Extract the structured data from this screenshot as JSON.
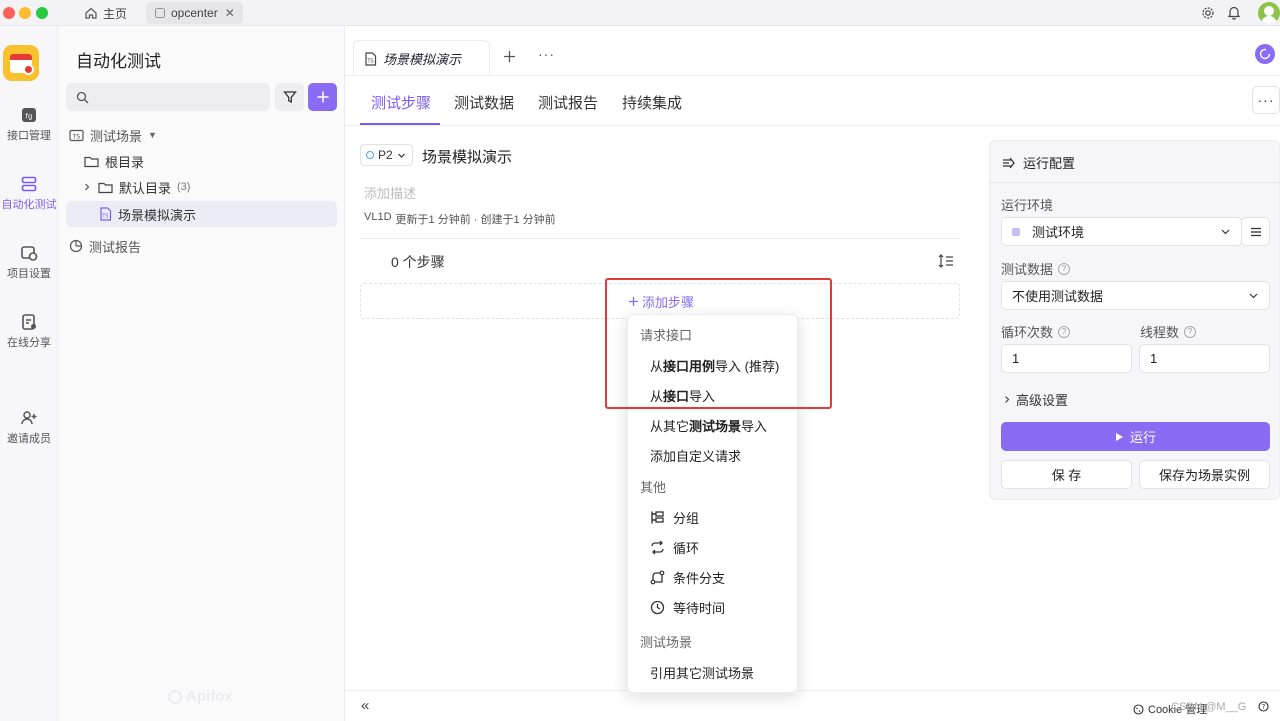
{
  "titlebar": {
    "home_tab": "主页",
    "project_tab": "opcenter"
  },
  "rail": {
    "items": [
      {
        "label": "接口管理"
      },
      {
        "label": "自动化测试"
      },
      {
        "label": "项目设置"
      },
      {
        "label": "在线分享"
      },
      {
        "label": "邀请成员"
      }
    ]
  },
  "nav": {
    "title": "自动化测试",
    "search_placeholder": "",
    "tree": {
      "root_section": "测试场景",
      "root_dir": "根目录",
      "default_dir": "默认目录",
      "default_dir_count": "(3)",
      "scene_item": "场景模拟演示",
      "report_section": "测试报告"
    },
    "watermark": "Apifox"
  },
  "doc_tab": {
    "title": "场景模拟演示"
  },
  "subtabs": [
    "测试步骤",
    "测试数据",
    "测试报告",
    "持续集成"
  ],
  "scene": {
    "priority": "P2",
    "title": "场景模拟演示",
    "desc_placeholder": "添加描述",
    "meta_user": "VL1D",
    "meta_text": "更新于1 分钟前 · 创建于1 分钟前",
    "steps_count": "0 个步骤",
    "add_step": "添加步骤"
  },
  "menu": {
    "section_request": "请求接口",
    "item_import_case_pre": "从",
    "item_import_case_bold": "接口用例",
    "item_import_case_post": "导入 (推荐)",
    "item_import_api_pre": "从",
    "item_import_api_bold": "接口",
    "item_import_api_post": "导入",
    "item_import_scene_pre": "从其它",
    "item_import_scene_bold": "测试场景",
    "item_import_scene_post": "导入",
    "item_custom": "添加自定义请求",
    "section_other": "其他",
    "item_group": "分组",
    "item_loop": "循环",
    "item_branch": "条件分支",
    "item_wait": "等待时间",
    "section_scene": "测试场景",
    "item_ref_scene": "引用其它测试场景"
  },
  "run_config": {
    "title": "运行配置",
    "env_label": "运行环境",
    "env_value": "测试环境",
    "data_label": "测试数据",
    "data_value": "不使用测试数据",
    "loop_label": "循环次数",
    "loop_value": "1",
    "thread_label": "线程数",
    "thread_value": "1",
    "advanced": "高级设置",
    "run_button": "运行",
    "save_button": "保 存",
    "save_instance_button": "保存为场景实例"
  },
  "footer": {
    "cookie_text": "Cookie 管理",
    "csdn_text": "CSDN @M__G"
  },
  "colors": {
    "accent": "#7b5cf0",
    "highlight_box": "#e53935"
  }
}
